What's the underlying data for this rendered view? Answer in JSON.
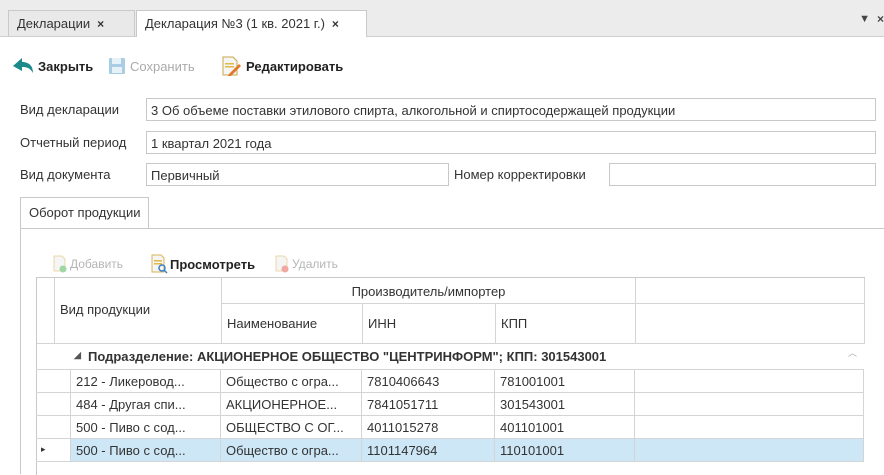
{
  "tabs": [
    {
      "label": "Декларации",
      "close": "×"
    },
    {
      "label": "Декларация №3 (1 кв. 2021 г.)",
      "close": "×"
    }
  ],
  "tab_menu": "▼",
  "tab_close": "×",
  "toolbar": {
    "close_label": "Закрыть",
    "save_label": "Сохранить",
    "edit_label": "Редактировать"
  },
  "form": {
    "decl_type_label": "Вид декларации",
    "decl_type_value": "3 Об объеме поставки этилового спирта, алкогольной и спиртосодержащей продукции",
    "period_label": "Отчетный период",
    "period_value": "1 квартал 2021 года",
    "doc_type_label": "Вид документа",
    "doc_type_value": "Первичный",
    "correction_label": "Номер корректировки",
    "correction_value": ""
  },
  "inner_tab": "Оборот продукции",
  "subtoolbar": {
    "add_label": "Добавить",
    "view_label": "Просмотреть",
    "delete_label": "Удалить"
  },
  "grid": {
    "col_product": "Вид продукции",
    "col_group": "Производитель/импортер",
    "col_name": "Наименование",
    "col_inn": "ИНН",
    "col_kpp": "КПП",
    "group_row": "Подразделение: АКЦИОНЕРНОЕ ОБЩЕСТВО \"ЦЕНТРИНФОРМ\"; КПП: 301543001",
    "rows": [
      {
        "product": "212 - Ликеровод...",
        "name": "Общество с огра...",
        "inn": "7810406643",
        "kpp": "781001001"
      },
      {
        "product": "484 - Другая спи...",
        "name": "АКЦИОНЕРНОЕ...",
        "inn": "7841051711",
        "kpp": "301543001"
      },
      {
        "product": "500 - Пиво с сод...",
        "name": "ОБЩЕСТВО С ОГ...",
        "inn": "4011015278",
        "kpp": "401101001"
      },
      {
        "product": "500 - Пиво с сод...",
        "name": "Общество с огра...",
        "inn": "1101147964",
        "kpp": "110101001"
      }
    ]
  },
  "colors": {
    "accent": "#1a8a8a",
    "selected_row": "#cde7f7"
  }
}
